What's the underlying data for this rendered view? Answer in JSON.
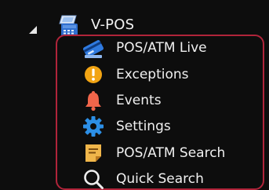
{
  "tree": {
    "root": {
      "label": "V-POS",
      "icon": "pos-terminal-icon",
      "expanded": true
    },
    "items": [
      {
        "label": "POS/ATM Live",
        "icon": "card-terminal-icon"
      },
      {
        "label": "Exceptions",
        "icon": "exclamation-icon"
      },
      {
        "label": "Events",
        "icon": "bell-icon"
      },
      {
        "label": "Settings",
        "icon": "gear-icon"
      },
      {
        "label": "POS/ATM Search",
        "icon": "note-icon"
      },
      {
        "label": "Quick Search",
        "icon": "search-icon"
      }
    ]
  },
  "colors": {
    "background": "#0d0d0d",
    "text": "#f0f0f0",
    "highlight_frame": "#b0243a",
    "exceptions_icon": "#f2a413",
    "events_icon": "#f0654a",
    "settings_icon": "#2c8fe6",
    "search_note_icon": "#f0b64a"
  }
}
